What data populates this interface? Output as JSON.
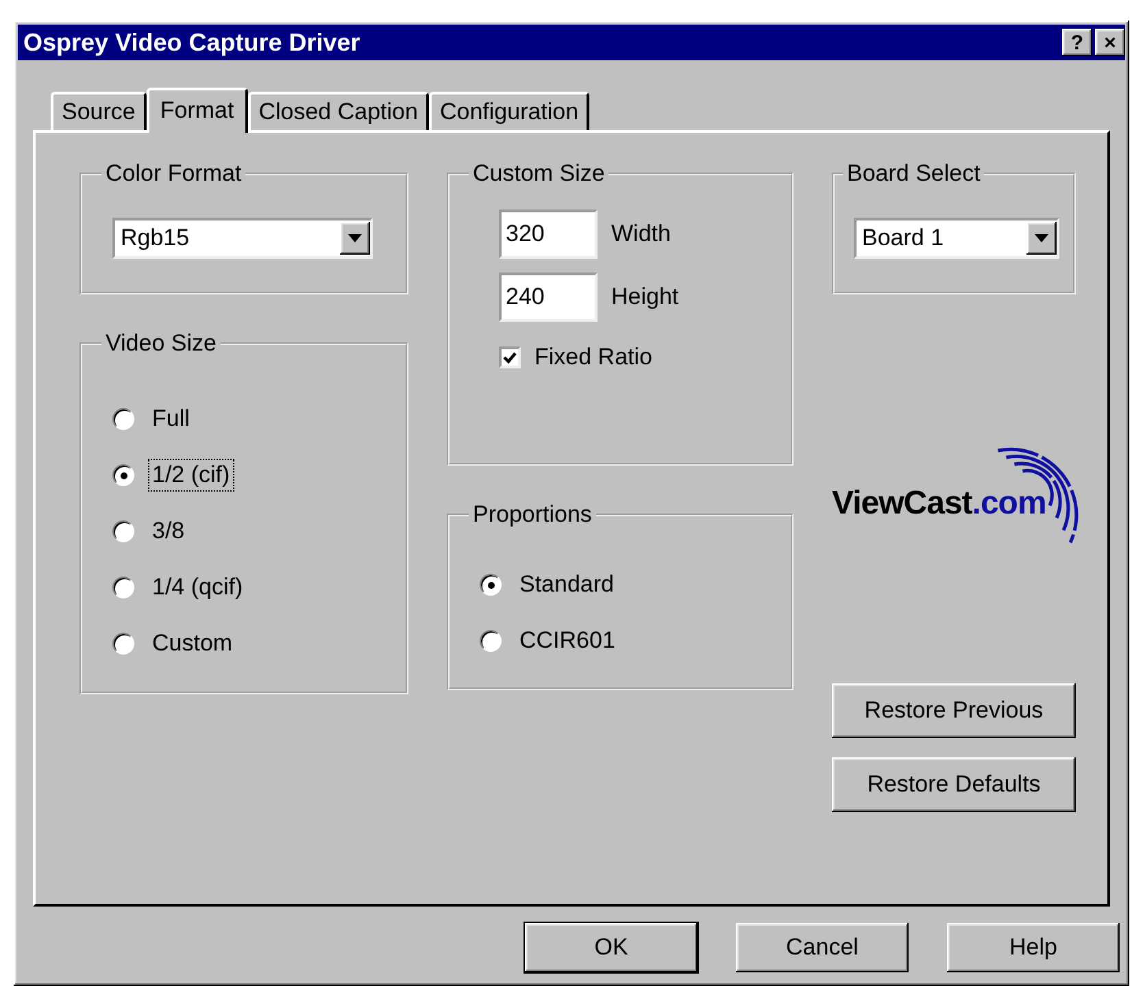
{
  "window": {
    "title": "Osprey Video Capture Driver",
    "title_buttons": [
      "?",
      "×"
    ]
  },
  "tabs": [
    {
      "label": "Source",
      "selected": false
    },
    {
      "label": "Format",
      "selected": true
    },
    {
      "label": "Closed Caption",
      "selected": false
    },
    {
      "label": "Configuration",
      "selected": false
    }
  ],
  "color_format": {
    "title": "Color Format",
    "value": "Rgb15"
  },
  "video_size": {
    "title": "Video Size",
    "options": [
      {
        "label": "Full",
        "selected": false
      },
      {
        "label": "1/2 (cif)",
        "selected": true
      },
      {
        "label": "3/8",
        "selected": false
      },
      {
        "label": "1/4 (qcif)",
        "selected": false
      },
      {
        "label": "Custom",
        "selected": false
      }
    ]
  },
  "custom_size": {
    "title": "Custom Size",
    "width": {
      "value": "320",
      "label": "Width"
    },
    "height": {
      "value": "240",
      "label": "Height"
    },
    "fixed_ratio": {
      "label": "Fixed Ratio",
      "checked": true
    }
  },
  "proportions": {
    "title": "Proportions",
    "options": [
      {
        "label": "Standard",
        "selected": true
      },
      {
        "label": "CCIR601",
        "selected": false
      }
    ]
  },
  "board_select": {
    "title": "Board Select",
    "value": "Board 1"
  },
  "logo": {
    "text": "ViewCast",
    "suffix": ".com"
  },
  "side_buttons": [
    "Restore Previous",
    "Restore Defaults"
  ],
  "buttons": [
    {
      "label": "OK",
      "default": true
    },
    {
      "label": "Cancel",
      "default": false
    },
    {
      "label": "Help",
      "default": false
    }
  ]
}
